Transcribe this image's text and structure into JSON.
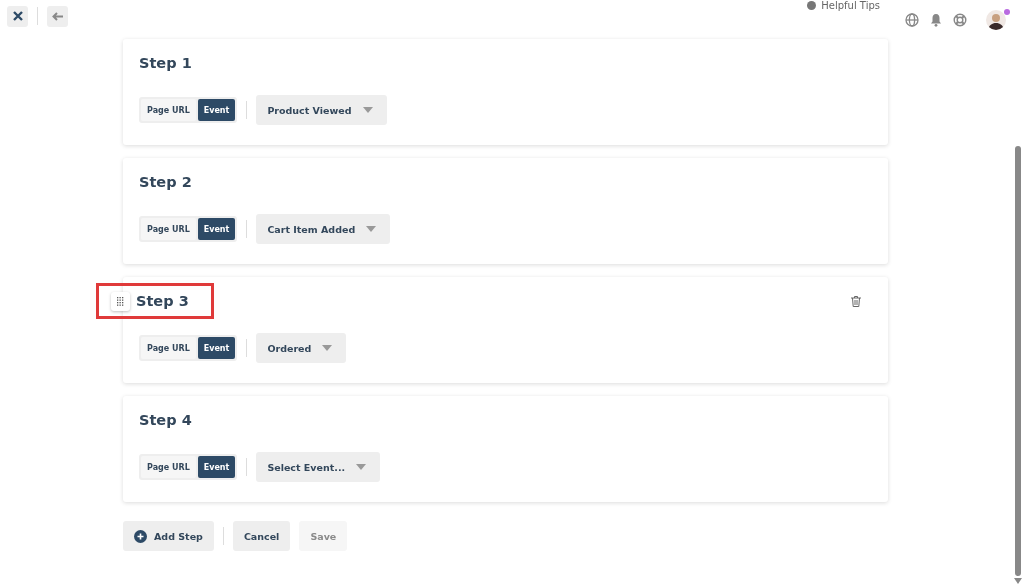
{
  "header": {
    "helpful_tips": "Helpful Tips",
    "avatar": {
      "notification": true
    }
  },
  "steps": [
    {
      "title": "Step 1",
      "hovered": false,
      "highlighted": false,
      "source_options": [
        {
          "label": "Page URL",
          "selected": false
        },
        {
          "label": "Event",
          "selected": true
        }
      ],
      "event": {
        "value": "Product Viewed"
      }
    },
    {
      "title": "Step 2",
      "hovered": false,
      "highlighted": false,
      "source_options": [
        {
          "label": "Page URL",
          "selected": false
        },
        {
          "label": "Event",
          "selected": true
        }
      ],
      "event": {
        "value": "Cart Item Added"
      }
    },
    {
      "title": "Step 3",
      "hovered": true,
      "highlighted": true,
      "source_options": [
        {
          "label": "Page URL",
          "selected": false
        },
        {
          "label": "Event",
          "selected": true
        }
      ],
      "event": {
        "value": "Ordered"
      }
    },
    {
      "title": "Step 4",
      "hovered": false,
      "highlighted": false,
      "source_options": [
        {
          "label": "Page URL",
          "selected": false
        },
        {
          "label": "Event",
          "selected": true
        }
      ],
      "event": {
        "placeholder": "Select Event..."
      }
    }
  ],
  "actions": [
    {
      "label": "Add Step",
      "kind": "add",
      "disabled": false
    },
    {
      "label": "Cancel",
      "kind": "plain",
      "disabled": false
    },
    {
      "label": "Save",
      "kind": "plain",
      "disabled": true
    }
  ]
}
